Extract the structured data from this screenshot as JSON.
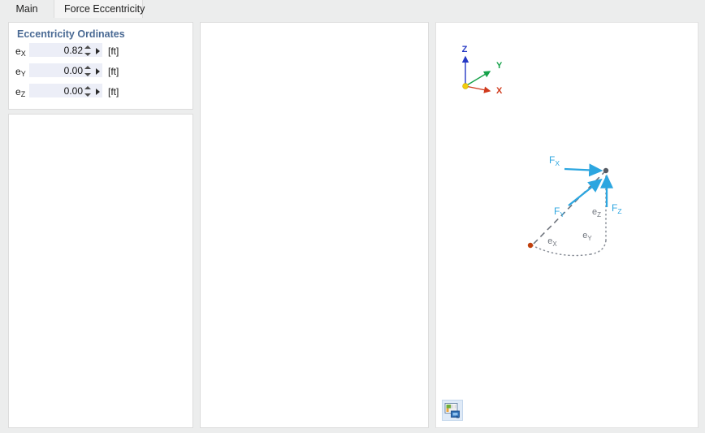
{
  "window": {
    "background_color": "#eceded"
  },
  "tabs": [
    {
      "id": "main",
      "label": "Main",
      "active": false
    },
    {
      "id": "force-eccentricity",
      "label": "Force Eccentricity",
      "active": true
    }
  ],
  "left_panel": {
    "groupbox": {
      "title": "Eccentricity Ordinates",
      "title_color": "#4a6a94",
      "fields": [
        {
          "label": "e",
          "subscript": "X",
          "value": "0.82",
          "unit": "[ft]"
        },
        {
          "label": "e",
          "subscript": "Y",
          "value": "0.00",
          "unit": "[ft]"
        },
        {
          "label": "e",
          "subscript": "Z",
          "value": "0.00",
          "unit": "[ft]"
        }
      ]
    }
  },
  "view_panel": {
    "image_button_icon": "picture-icon",
    "axis_triad": {
      "origin_dot_color": "#f2cc0c",
      "axes": [
        {
          "name": "Z",
          "label": "Z",
          "color": "#2438c4"
        },
        {
          "name": "Y",
          "label": "Y",
          "color": "#16a24a"
        },
        {
          "name": "X",
          "label": "X",
          "color": "#d03a1c"
        }
      ]
    },
    "force_vectors": [
      {
        "name": "FX",
        "label": "F",
        "subscript": "X",
        "color": "#2ca6e0"
      },
      {
        "name": "FY",
        "label": "F",
        "subscript": "Y",
        "color": "#2ca6e0"
      },
      {
        "name": "FZ",
        "label": "F",
        "subscript": "Z",
        "color": "#2ca6e0"
      }
    ],
    "eccentricity_labels": [
      {
        "name": "eX",
        "label": "e",
        "subscript": "X",
        "color": "#737880"
      },
      {
        "name": "eY",
        "label": "e",
        "subscript": "Y",
        "color": "#737880"
      },
      {
        "name": "eZ",
        "label": "e",
        "subscript": "Z",
        "color": "#737880"
      }
    ],
    "node_dot_color": "#555a63",
    "origin_dot_color": "#c0400d"
  }
}
